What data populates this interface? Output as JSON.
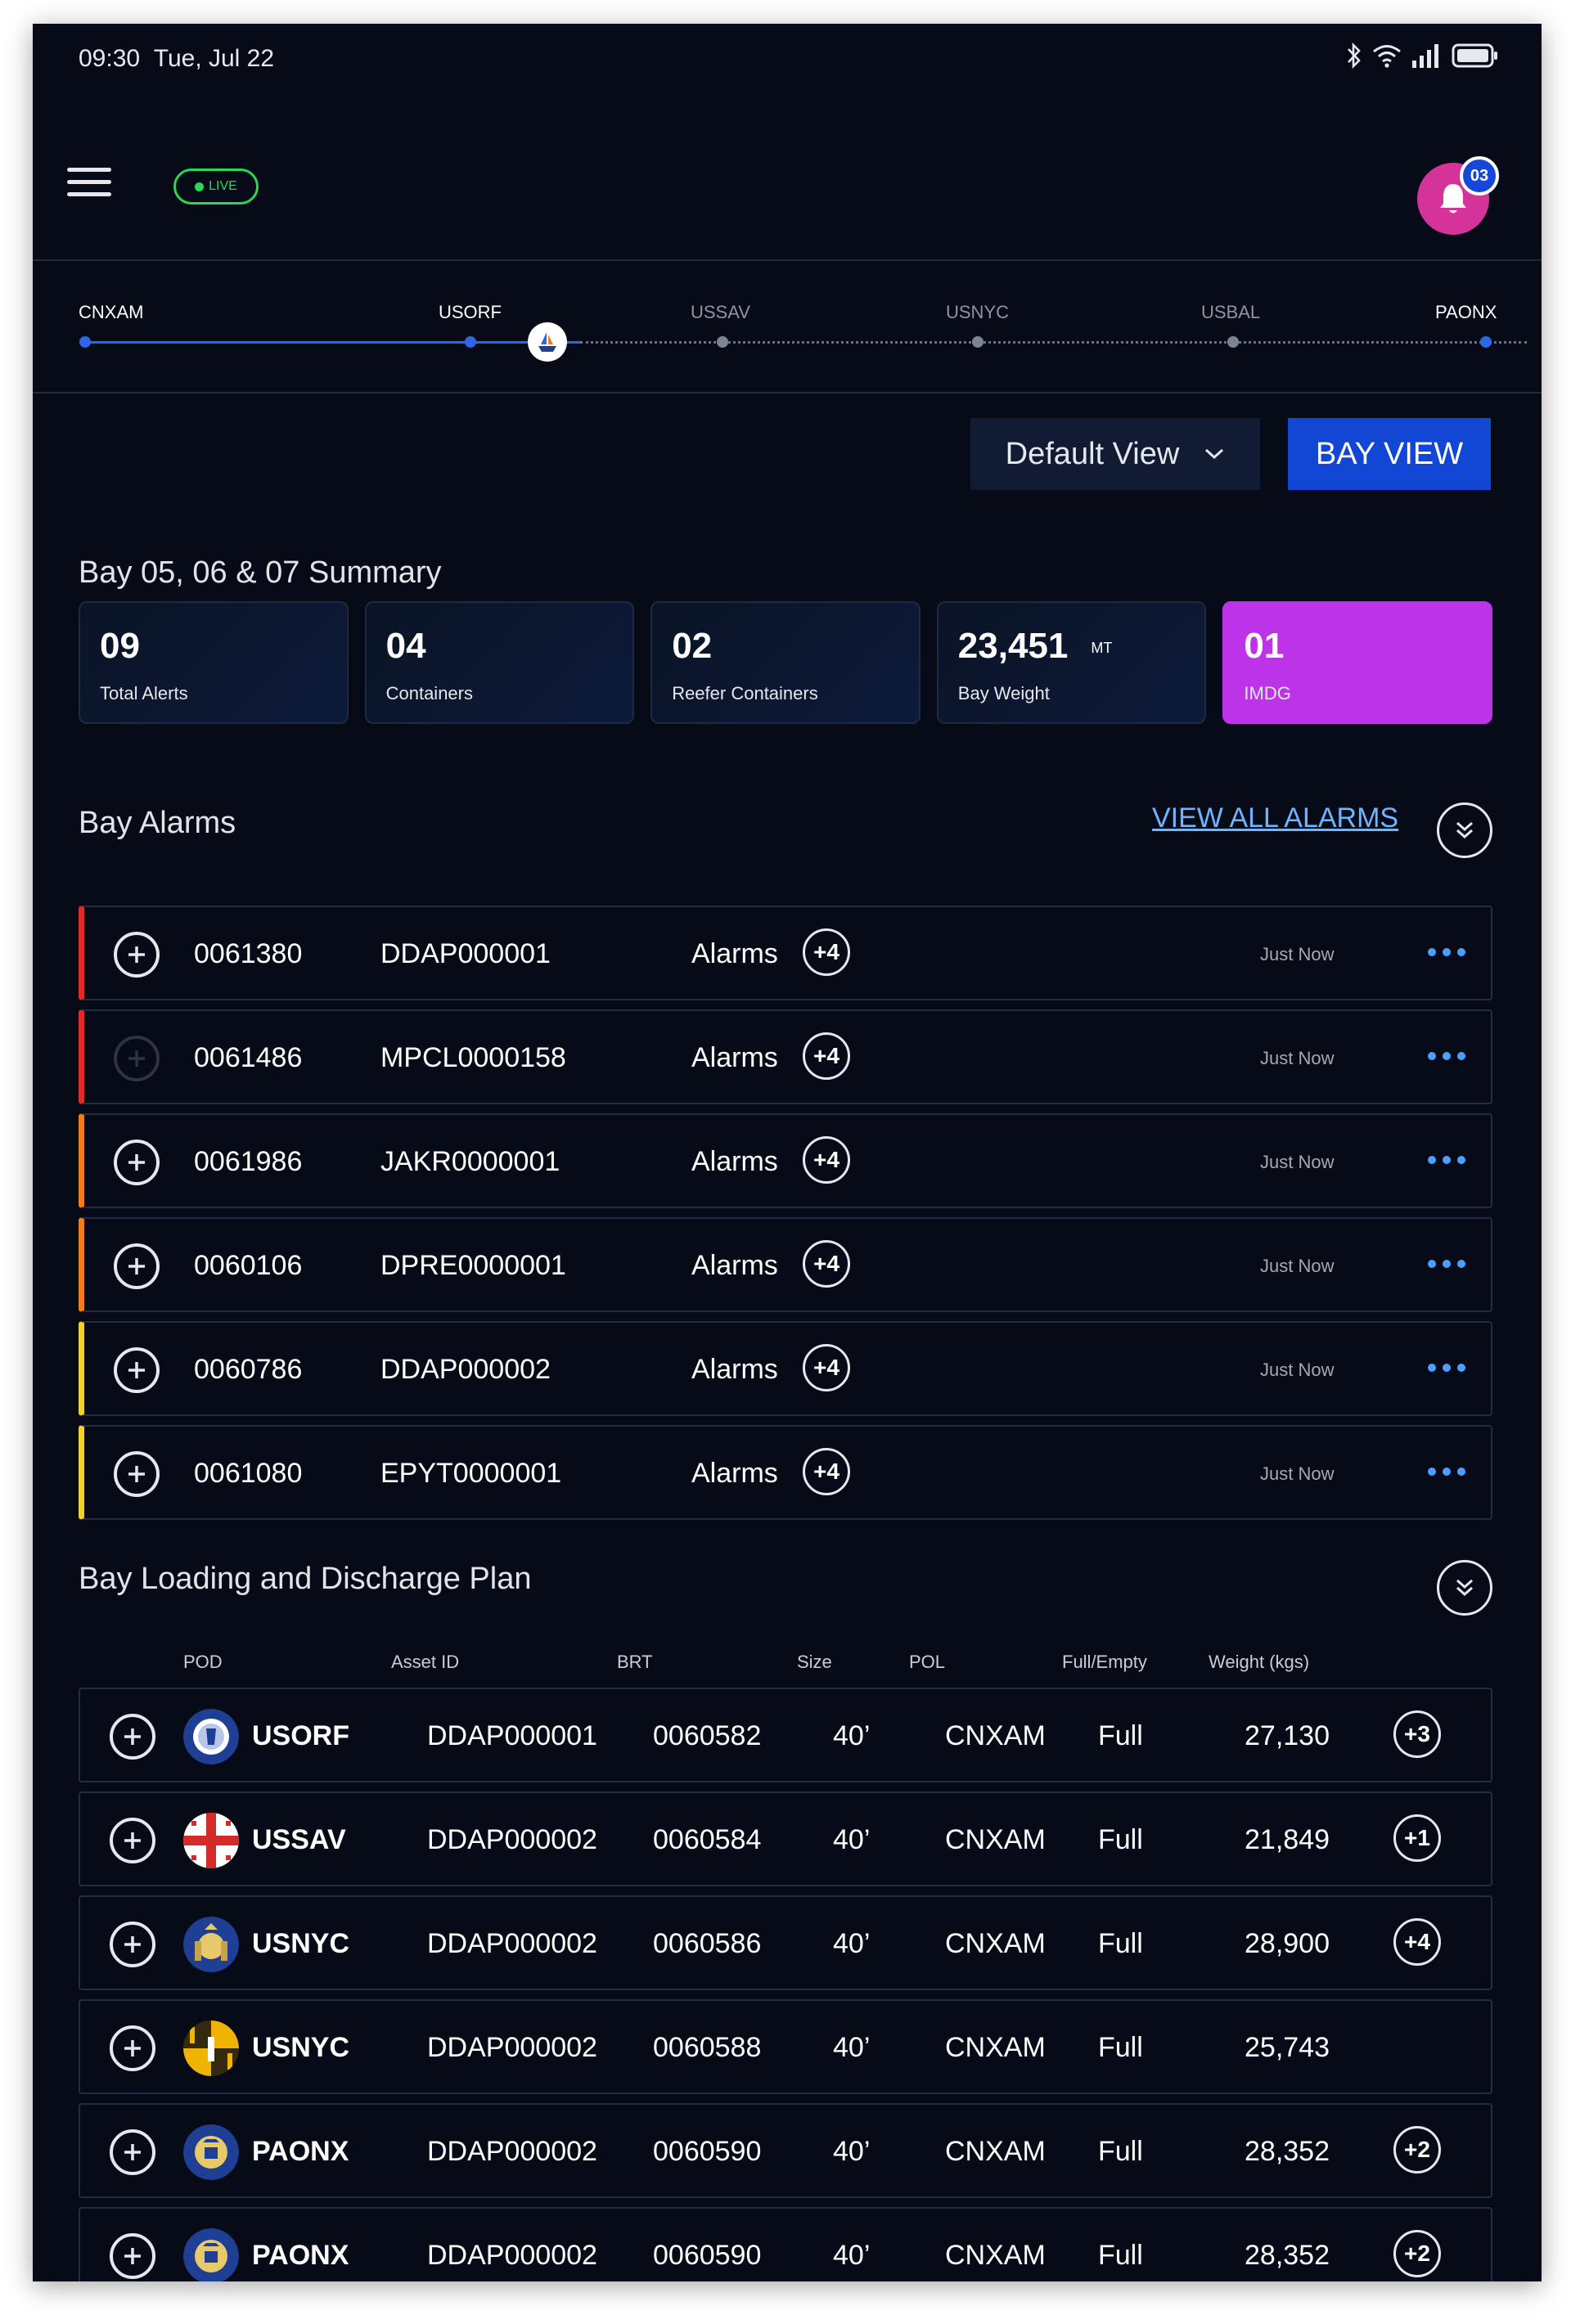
{
  "status_bar": {
    "time": "09:30",
    "date": "Tue, Jul 22"
  },
  "header": {
    "live_label": "LIVE",
    "notification_count": "03"
  },
  "route": {
    "stops": [
      "CNXAM",
      "USORF",
      "USSAV",
      "USNYC",
      "USBAL",
      "PAONX"
    ]
  },
  "toolbar": {
    "view_select": "Default View",
    "bay_view_label": "BAY VIEW"
  },
  "summary": {
    "title": "Bay 05, 06 & 07 Summary",
    "cards": [
      {
        "value": "09",
        "unit": "",
        "label": "Total Alerts"
      },
      {
        "value": "04",
        "unit": "",
        "label": "Containers"
      },
      {
        "value": "02",
        "unit": "",
        "label": "Reefer Containers"
      },
      {
        "value": "23,451",
        "unit": "MT",
        "label": "Bay Weight"
      },
      {
        "value": "01",
        "unit": "",
        "label": "IMDG"
      }
    ]
  },
  "alarms": {
    "title": "Bay Alarms",
    "view_all": "VIEW ALL ALARMS",
    "rows": [
      {
        "id": "0061380",
        "asset": "DDAP000001",
        "label": "Alarms",
        "extra": "+4",
        "time": "Just Now",
        "color": "#e32a2a"
      },
      {
        "id": "0061486",
        "asset": "MPCL0000158",
        "label": "Alarms",
        "extra": "+4",
        "time": "Just Now",
        "color": "#e32a2a"
      },
      {
        "id": "0061986",
        "asset": "JAKR0000001",
        "label": "Alarms",
        "extra": "+4",
        "time": "Just Now",
        "color": "#f07c1a"
      },
      {
        "id": "0060106",
        "asset": "DPRE0000001",
        "label": "Alarms",
        "extra": "+4",
        "time": "Just Now",
        "color": "#f07c1a"
      },
      {
        "id": "0060786",
        "asset": "DDAP000002",
        "label": "Alarms",
        "extra": "+4",
        "time": "Just Now",
        "color": "#f2d22a"
      },
      {
        "id": "0061080",
        "asset": "EPYT0000001",
        "label": "Alarms",
        "extra": "+4",
        "time": "Just Now",
        "color": "#f2d22a"
      }
    ]
  },
  "plan": {
    "title": "Bay Loading and Discharge Plan",
    "columns": [
      "POD",
      "Asset ID",
      "BRT",
      "Size",
      "POL",
      "Full/Empty",
      "Weight (kgs)"
    ],
    "rows": [
      {
        "pod": "USORF",
        "seal": "virginia-seal",
        "asset": "DDAP000001",
        "brt": "0060582",
        "size": "40’",
        "pol": "CNXAM",
        "fe": "Full",
        "weight": "27,130",
        "extra": "+3"
      },
      {
        "pod": "USSAV",
        "seal": "georgia-flag",
        "asset": "DDAP000002",
        "brt": "0060584",
        "size": "40’",
        "pol": "CNXAM",
        "fe": "Full",
        "weight": "21,849",
        "extra": "+1"
      },
      {
        "pod": "USNYC",
        "seal": "newyork-seal",
        "asset": "DDAP000002",
        "brt": "0060586",
        "size": "40’",
        "pol": "CNXAM",
        "fe": "Full",
        "weight": "28,900",
        "extra": "+4"
      },
      {
        "pod": "USNYC",
        "seal": "maryland-flag",
        "asset": "DDAP000002",
        "brt": "0060588",
        "size": "40’",
        "pol": "CNXAM",
        "fe": "Full",
        "weight": "25,743",
        "extra": ""
      },
      {
        "pod": "PAONX",
        "seal": "pennsylvania-seal",
        "asset": "DDAP000002",
        "brt": "0060590",
        "size": "40’",
        "pol": "CNXAM",
        "fe": "Full",
        "weight": "28,352",
        "extra": "+2"
      },
      {
        "pod": "PAONX",
        "seal": "pennsylvania-seal",
        "asset": "DDAP000002",
        "brt": "0060590",
        "size": "40’",
        "pol": "CNXAM",
        "fe": "Full",
        "weight": "28,352",
        "extra": "+2"
      }
    ]
  }
}
